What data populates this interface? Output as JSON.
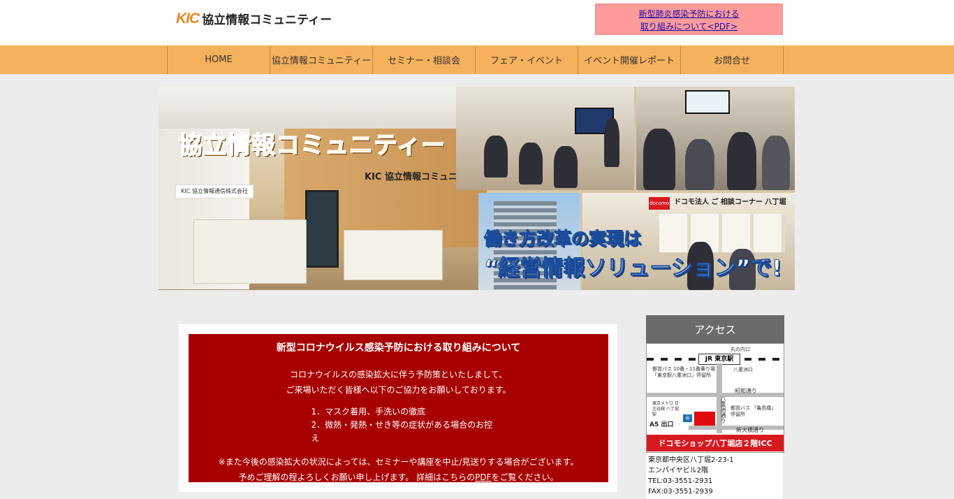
{
  "header": {
    "logo_mark": "KIC",
    "logo_text": "協立情報コミュニティー",
    "notice_line1": "新型肺炎感染予防における",
    "notice_line2": "取り組みについて<PDF>"
  },
  "nav": {
    "items": [
      {
        "label": "HOME"
      },
      {
        "label": "協立情報コミュニティー"
      },
      {
        "label": "セミナー・相談会"
      },
      {
        "label": "フェア・イベント"
      },
      {
        "label": "イベント開催レポート"
      },
      {
        "label": "お問合せ"
      }
    ]
  },
  "hero": {
    "title": "協立情報コミュニティー",
    "wall_sign": "KIC 協立情報コミュニティー",
    "reception_sign": "KIC 協立情報通信株式会社",
    "docomo_banner": "ドコモ法人 ご 相談コーナー 八丁堀",
    "docomo_logo": "docomo",
    "slogan_line1": "働き方改革の実現は",
    "slogan_line2": "“経営情報ソリューション”で!"
  },
  "covid": {
    "title": "新型コロナウイルス感染予防における取り組みについて",
    "intro_line1": "コロナウイルスの感染拡大に伴う予防策といたしまして、",
    "intro_line2": "ご来場いただく皆様へ以下のご協力をお願いしております。",
    "items": [
      "1．マスク着用、手洗いの徹底",
      "2．微熱・発熱・せき等の症状がある場合のお控え"
    ],
    "note_line1": "※また今後の感染拡大の状況によっては、セミナーや講座を中止/見送りする場合がございます。",
    "note_line2_pre": "予めご理解の程よろしくお願い申し上げます。 詳細はこちらの",
    "note_link": "PDF",
    "note_line2_post": "をご覧ください。"
  },
  "access": {
    "heading": "アクセス",
    "map": {
      "station": "JR 東京駅",
      "marunouchi": "丸の内口",
      "yaesu": "八重洲口",
      "bus1": "都営バス 10番・11番乗り場 「東京駅八重洲口」停留所",
      "bus2": "都営バス 「亀島橋」停留所",
      "showa": "昭和通り",
      "yaesu_dori": "八重洲通り",
      "metro": "東京メトロ 日比谷線 八丁堀駅",
      "exit": "A5 出口",
      "shinohashi": "新大橋通り",
      "shop_banner": "ドコモショップ八丁堀店２階ICC"
    },
    "address_line1": "東京都中央区八丁堀2-23-1",
    "address_line2": "エンパイヤビル2階",
    "tel": "TEL:03-3551-2931",
    "fax": "FAX:03-3551-2939"
  },
  "colors": {
    "nav_bg": "#f6b15c",
    "notice_bg": "#fd9a9a",
    "covid_bg": "#a80000",
    "access_header_bg": "#6b6b6b",
    "brand_orange": "#e8871e"
  }
}
